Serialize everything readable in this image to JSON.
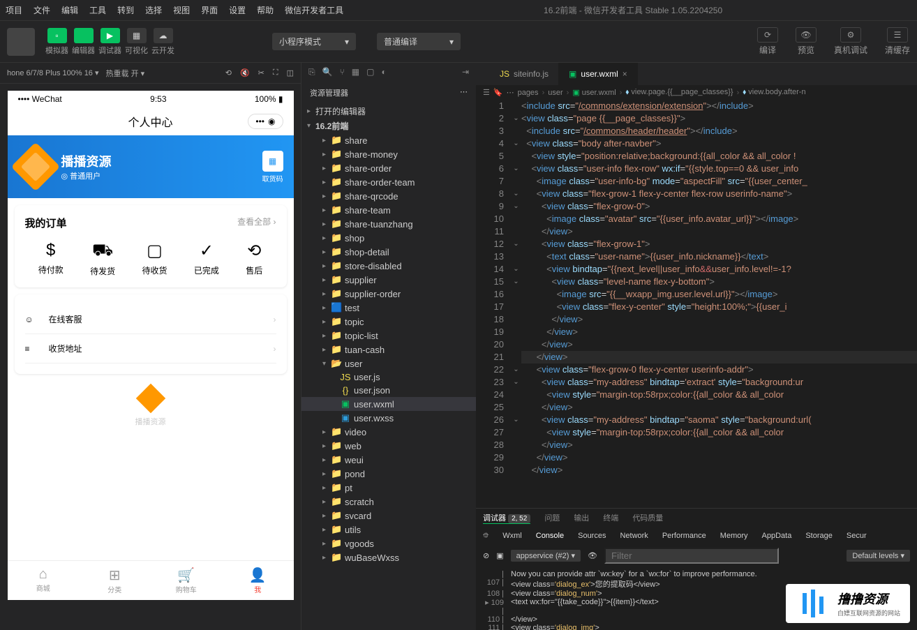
{
  "menu": [
    "项目",
    "文件",
    "编辑",
    "工具",
    "转到",
    "选择",
    "视图",
    "界面",
    "设置",
    "帮助",
    "微信开发者工具"
  ],
  "window_title": "16.2前端 - 微信开发者工具 Stable 1.05.2204250",
  "toolbar_buttons": [
    {
      "label": "模拟器",
      "icon": "▫"
    },
    {
      "label": "编辑器",
      "icon": "</>"
    },
    {
      "label": "调试器",
      "icon": "▶"
    },
    {
      "label": "可视化",
      "icon": "▦"
    },
    {
      "label": "云开发",
      "icon": "☁"
    }
  ],
  "mode_select": "小程序模式",
  "compile_select": "普通编译",
  "toolbar_right": [
    {
      "label": "编译",
      "icon": "⟳"
    },
    {
      "label": "预览",
      "icon": "👁"
    },
    {
      "label": "真机调试",
      "icon": "⚙"
    },
    {
      "label": "清缓存",
      "icon": "☰"
    }
  ],
  "sim_bar": {
    "device": "hone 6/7/8 Plus 100% 16 ▾",
    "reload": "热重载 开 ▾"
  },
  "phone": {
    "carrier": "•••• WeChat",
    "time": "9:53",
    "battery": "100%",
    "nav_title": "个人中心",
    "user": {
      "name": "播播资源",
      "level": "普通用户",
      "qr_label": "取货码"
    },
    "orders": {
      "title": "我的订单",
      "view_all": "查看全部",
      "items": [
        "待付款",
        "待发货",
        "待收货",
        "已完成",
        "售后"
      ],
      "icons": [
        "$",
        "⛟",
        "▢",
        "✓",
        "⟲"
      ]
    },
    "menu": [
      {
        "icon": "☺",
        "label": "在线客服"
      },
      {
        "icon": "≡",
        "label": "收货地址"
      }
    ],
    "logo_label": "播播资源",
    "tabs": [
      {
        "icon": "⌂",
        "label": "商城"
      },
      {
        "icon": "⊞",
        "label": "分类"
      },
      {
        "icon": "🛒",
        "label": "购物车"
      },
      {
        "icon": "👤",
        "label": "我"
      }
    ]
  },
  "explorer": {
    "title": "资源管理器",
    "sections": [
      "打开的编辑器",
      "16.2前端"
    ],
    "folders": [
      "share",
      "share-money",
      "share-order",
      "share-order-team",
      "share-qrcode",
      "share-team",
      "share-tuanzhang",
      "shop",
      "shop-detail",
      "store-disabled",
      "supplier",
      "supplier-order",
      "test",
      "topic",
      "topic-list",
      "tuan-cash",
      "user",
      "video",
      "web",
      "weui",
      "pond",
      "pt",
      "scratch",
      "svcard",
      "utils",
      "vgoods",
      "wuBaseWxss"
    ],
    "user_files": [
      {
        "name": "user.js",
        "icon": "JS",
        "color": "#f0db4f"
      },
      {
        "name": "user.json",
        "icon": "{}",
        "color": "#f0db4f"
      },
      {
        "name": "user.wxml",
        "icon": "▣",
        "color": "#07c160"
      },
      {
        "name": "user.wxss",
        "icon": "▣",
        "color": "#2d9cdb"
      }
    ]
  },
  "editor": {
    "tabs": [
      {
        "name": "siteinfo.js",
        "icon": "JS"
      },
      {
        "name": "user.wxml",
        "icon": "▣",
        "active": true
      }
    ],
    "breadcrumb": [
      "pages",
      "user",
      "user.wxml",
      "view.page.{{__page_classes}}",
      "view.body.after-n"
    ],
    "lines": [
      {
        "n": 1,
        "fold": "",
        "html": "<span class='tag'>&lt;</span><span class='tagname'>include</span> <span class='attr'>src</span>=<span class='str'>\"</span><span class='str-link'>/commons/extension/extension</span><span class='str'>\"</span><span class='tag'>&gt;&lt;/</span><span class='tagname'>include</span><span class='tag'>&gt;</span>"
      },
      {
        "n": 2,
        "fold": "v",
        "html": "<span class='tag'>&lt;</span><span class='tagname'>view</span> <span class='attr'>class</span>=<span class='str'>\"page </span><span class='expr'>{{__page_classes}}</span><span class='str'>\"</span><span class='tag'>&gt;</span>"
      },
      {
        "n": 3,
        "fold": "",
        "html": "  <span class='tag'>&lt;</span><span class='tagname'>include</span> <span class='attr'>src</span>=<span class='str'>\"</span><span class='str-link'>/commons/header/header</span><span class='str'>\"</span><span class='tag'>&gt;&lt;/</span><span class='tagname'>include</span><span class='tag'>&gt;</span>"
      },
      {
        "n": 4,
        "fold": "v",
        "html": "  <span class='tag'>&lt;</span><span class='tagname'>view</span> <span class='attr'>class</span>=<span class='str'>\"body after-navber\"</span><span class='tag'>&gt;</span>"
      },
      {
        "n": 5,
        "fold": "",
        "html": "    <span class='tag'>&lt;</span><span class='tagname'>view</span> <span class='attr'>style</span>=<span class='str'>\"position:relative;background:</span><span class='expr'>{{all_color && all_color !</span>"
      },
      {
        "n": 6,
        "fold": "v",
        "html": "    <span class='tag'>&lt;</span><span class='tagname'>view</span> <span class='attr'>class</span>=<span class='str'>\"user-info flex-row\"</span> <span class='attr'>wx:if</span>=<span class='str'>\"</span><span class='expr'>{{style.top==0 && user_info</span>"
      },
      {
        "n": 7,
        "fold": "",
        "html": "      <span class='tag'>&lt;</span><span class='tagname'>image</span> <span class='attr'>class</span>=<span class='str'>\"user-info-bg\"</span> <span class='attr'>mode</span>=<span class='str'>\"aspectFill\"</span> <span class='attr'>src</span>=<span class='str'>\"</span><span class='expr'>{{user_center_</span>"
      },
      {
        "n": 8,
        "fold": "v",
        "html": "      <span class='tag'>&lt;</span><span class='tagname'>view</span> <span class='attr'>class</span>=<span class='str'>\"flex-grow-1 flex-y-center flex-row userinfo-name\"</span><span class='tag'>&gt;</span>"
      },
      {
        "n": 9,
        "fold": "v",
        "html": "        <span class='tag'>&lt;</span><span class='tagname'>view</span> <span class='attr'>class</span>=<span class='str'>\"flex-grow-0\"</span><span class='tag'>&gt;</span>"
      },
      {
        "n": 10,
        "fold": "",
        "html": "          <span class='tag'>&lt;</span><span class='tagname'>image</span> <span class='attr'>class</span>=<span class='str'>\"avatar\"</span> <span class='attr'>src</span>=<span class='str'>\"</span><span class='expr'>{{user_info.avatar_url}}</span><span class='str'>\"</span><span class='tag'>&gt;&lt;/</span><span class='tagname'>image</span><span class='tag'>&gt;</span>"
      },
      {
        "n": 11,
        "fold": "",
        "html": "        <span class='tag'>&lt;/</span><span class='tagname'>view</span><span class='tag'>&gt;</span>"
      },
      {
        "n": 12,
        "fold": "v",
        "html": "        <span class='tag'>&lt;</span><span class='tagname'>view</span> <span class='attr'>class</span>=<span class='str'>\"flex-grow-1\"</span><span class='tag'>&gt;</span>"
      },
      {
        "n": 13,
        "fold": "",
        "html": "          <span class='tag'>&lt;</span><span class='tagname'>text</span> <span class='attr'>class</span>=<span class='str'>\"user-name\"</span><span class='tag'>&gt;</span><span class='expr'>{{user_info.nickname}}</span><span class='tag'>&lt;/</span><span class='tagname'>text</span><span class='tag'>&gt;</span>"
      },
      {
        "n": 14,
        "fold": "v",
        "html": "          <span class='tag'>&lt;</span><span class='tagname'>view</span> <span class='attr'>bindtap</span>=<span class='str'>\"</span><span class='expr'>{{next_level||user_info</span><span style='color:#d16969'>&&</span><span class='expr'>user_info.level!=-1?</span>"
      },
      {
        "n": 15,
        "fold": "v",
        "html": "            <span class='tag'>&lt;</span><span class='tagname'>view</span> <span class='attr'>class</span>=<span class='str'>\"level-name flex-y-bottom\"</span><span class='tag'>&gt;</span>"
      },
      {
        "n": 16,
        "fold": "",
        "html": "              <span class='tag'>&lt;</span><span class='tagname'>image</span> <span class='attr'>src</span>=<span class='str'>\"</span><span class='expr'>{{__wxapp_img.user.level.url}}</span><span class='str'>\"</span><span class='tag'>&gt;&lt;/</span><span class='tagname'>image</span><span class='tag'>&gt;</span>"
      },
      {
        "n": 17,
        "fold": "",
        "html": "              <span class='tag'>&lt;</span><span class='tagname'>view</span> <span class='attr'>class</span>=<span class='str'>\"flex-y-center\"</span> <span class='attr'>style</span>=<span class='str'>\"height:100%;\"</span><span class='tag'>&gt;</span><span class='expr'>{{user_i</span>"
      },
      {
        "n": 18,
        "fold": "",
        "html": "            <span class='tag'>&lt;/</span><span class='tagname'>view</span><span class='tag'>&gt;</span>"
      },
      {
        "n": 19,
        "fold": "",
        "html": "          <span class='tag'>&lt;/</span><span class='tagname'>view</span><span class='tag'>&gt;</span>"
      },
      {
        "n": 20,
        "fold": "",
        "html": "        <span class='tag'>&lt;/</span><span class='tagname'>view</span><span class='tag'>&gt;</span>"
      },
      {
        "n": 21,
        "fold": "",
        "hl": true,
        "html": "      <span class='tag'>&lt;/</span><span class='tagname'>view</span><span class='tag'>&gt;</span>"
      },
      {
        "n": 22,
        "fold": "v",
        "html": "      <span class='tag'>&lt;</span><span class='tagname'>view</span> <span class='attr'>class</span>=<span class='str'>\"flex-grow-0 flex-y-center userinfo-addr\"</span><span class='tag'>&gt;</span>"
      },
      {
        "n": 23,
        "fold": "v",
        "html": "        <span class='tag'>&lt;</span><span class='tagname'>view</span> <span class='attr'>class</span>=<span class='str'>\"my-address\"</span> <span class='attr'>bindtap</span>=<span class='str'>'extract'</span> <span class='attr'>style</span>=<span class='str'>\"background:ur</span>"
      },
      {
        "n": 24,
        "fold": "",
        "html": "          <span class='tag'>&lt;</span><span class='tagname'>view</span> <span class='attr'>style</span>=<span class='str'>\"margin-top:58rpx;color:</span><span class='expr'>{{all_color && all_color </span>"
      },
      {
        "n": 25,
        "fold": "",
        "html": "        <span class='tag'>&lt;/</span><span class='tagname'>view</span><span class='tag'>&gt;</span>"
      },
      {
        "n": 26,
        "fold": "v",
        "html": "        <span class='tag'>&lt;</span><span class='tagname'>view</span> <span class='attr'>class</span>=<span class='str'>\"my-address\"</span> <span class='attr'>bindtap</span>=<span class='str'>\"saoma\"</span> <span class='attr'>style</span>=<span class='str'>\"background:url(</span>"
      },
      {
        "n": 27,
        "fold": "",
        "html": "          <span class='tag'>&lt;</span><span class='tagname'>view</span> <span class='attr'>style</span>=<span class='str'>\"margin-top:58rpx;color:</span><span class='expr'>{{all_color && all_color </span>"
      },
      {
        "n": 28,
        "fold": "",
        "html": "        <span class='tag'>&lt;/</span><span class='tagname'>view</span><span class='tag'>&gt;</span>"
      },
      {
        "n": 29,
        "fold": "",
        "html": "      <span class='tag'>&lt;/</span><span class='tagname'>view</span><span class='tag'>&gt;</span>"
      },
      {
        "n": 30,
        "fold": "",
        "html": "    <span class='tag'>&lt;/</span><span class='tagname'>view</span><span class='tag'>&gt;</span>"
      }
    ]
  },
  "bottom": {
    "tabs": [
      "调试器",
      "问题",
      "输出",
      "终端",
      "代码质量"
    ],
    "count": "2, 52",
    "devtabs": [
      "Wxml",
      "Console",
      "Sources",
      "Network",
      "Performance",
      "Memory",
      "AppData",
      "Storage",
      "Secur"
    ],
    "context": "appservice (#2)",
    "filter_placeholder": "Filter",
    "levels": "Default levels ▾",
    "console": [
      {
        "ln": "",
        "txt": "Now you can provide attr `wx:key` for a `wx:for` to improve performance."
      },
      {
        "ln": "107",
        "txt": "   <view class='dialog_ex'>您的提取码</view>"
      },
      {
        "ln": "108",
        "txt": "   <view class='dialog_num'>"
      },
      {
        "ln": "▸ 109",
        "txt": "     <text wx:for=\"{{take_code}}\">{{item}}</text>"
      },
      {
        "ln": "110",
        "txt": "   </view>"
      },
      {
        "ln": "111",
        "txt": "   <view class='dialog_img'>"
      }
    ]
  },
  "watermark": {
    "title": "撸撸资源",
    "sub": "白嫖互联网资源的网站"
  }
}
